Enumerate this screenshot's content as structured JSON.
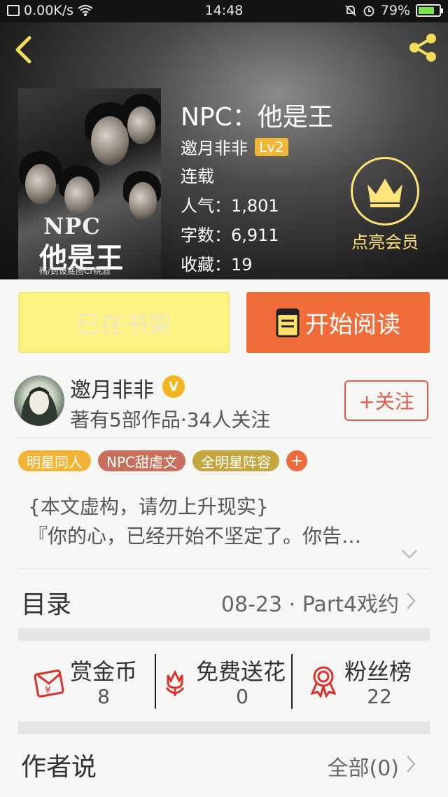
{
  "status_bar": {
    "network_speed": "0.00K/s",
    "time": "14:48",
    "battery": "79%",
    "battery_level": 0.79
  },
  "book": {
    "title": "NPC：他是王",
    "author": "邀月非非",
    "level": "Lv2",
    "status": "连载",
    "popularity": "人气：1,801",
    "word_count": "字数：6,911",
    "favorites": "收藏：19",
    "cover": {
      "line1": "NPC",
      "line2": "他是王",
      "credit": "殇/封设底图Cr桃酒"
    }
  },
  "vip": {
    "label": "点亮会员",
    "color": "#ffe47a"
  },
  "actions": {
    "shelf_label": "已在书架",
    "read_label": "开始阅读",
    "read_color": "#f06d3a",
    "shelf_color": "#fcf382"
  },
  "author_card": {
    "name": "邀月非非",
    "badge": "V",
    "stats": "著有5部作品·34人关注",
    "follow_label": "+关注"
  },
  "tags": [
    {
      "label": "明星同人",
      "color": "#f2b434"
    },
    {
      "label": "NPC甜虐文",
      "color": "#c8705c"
    },
    {
      "label": "全明星阵容",
      "color": "#c4a63e"
    }
  ],
  "tag_more": "+",
  "description": {
    "line1": "{本文虚构，请勿上升现实}",
    "line2": "『你的心，已经开始不坚定了。你告…"
  },
  "catalogue": {
    "label": "目录",
    "latest": "08-23 · Part4戏约"
  },
  "stats": [
    {
      "label": "赏金币",
      "count": "8",
      "icon": "red-envelope-icon"
    },
    {
      "label": "免费送花",
      "count": "0",
      "icon": "flower-icon"
    },
    {
      "label": "粉丝榜",
      "count": "22",
      "icon": "ribbon-medal-icon"
    }
  ],
  "author_says": {
    "label": "作者说",
    "all": "全部(0)"
  }
}
